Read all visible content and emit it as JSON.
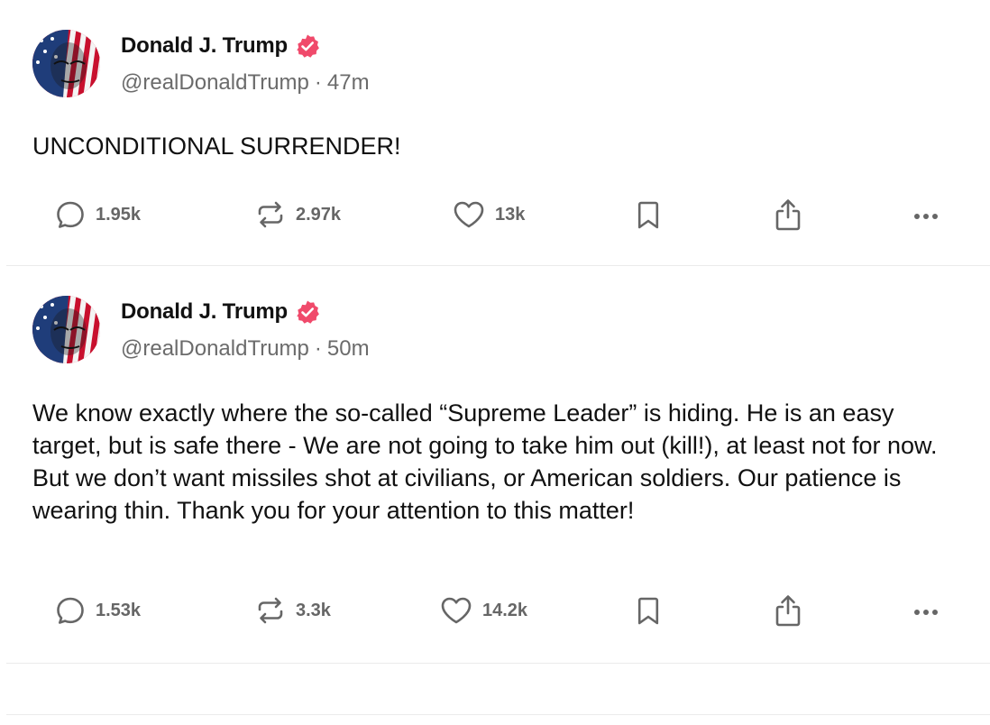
{
  "colors": {
    "verified": "#f04a6b",
    "text": "#111111",
    "muted": "#6b6b6b",
    "action": "#666666",
    "divider": "#ebebeb"
  },
  "icons": [
    "reply-icon",
    "repost-icon",
    "heart-icon",
    "bookmark-icon",
    "share-icon",
    "more-icon",
    "verified-badge-icon"
  ],
  "posts": [
    {
      "author": "Donald J. Trump",
      "handle": "@realDonaldTrump",
      "separator": "·",
      "time": "47m",
      "text": "UNCONDITIONAL SURRENDER!",
      "replies": "1.95k",
      "reposts": "2.97k",
      "likes": "13k"
    },
    {
      "author": "Donald J. Trump",
      "handle": "@realDonaldTrump",
      "separator": "·",
      "time": "50m",
      "text": "We know exactly where the so-called “Supreme Leader” is hiding. He is an easy target, but is safe there - We are not going to take him out (kill!), at least not for now. But we don’t want missiles shot at civilians, or American soldiers. Our patience is wearing thin. Thank you for your attention to this matter!",
      "replies": "1.53k",
      "reposts": "3.3k",
      "likes": "14.2k"
    }
  ]
}
